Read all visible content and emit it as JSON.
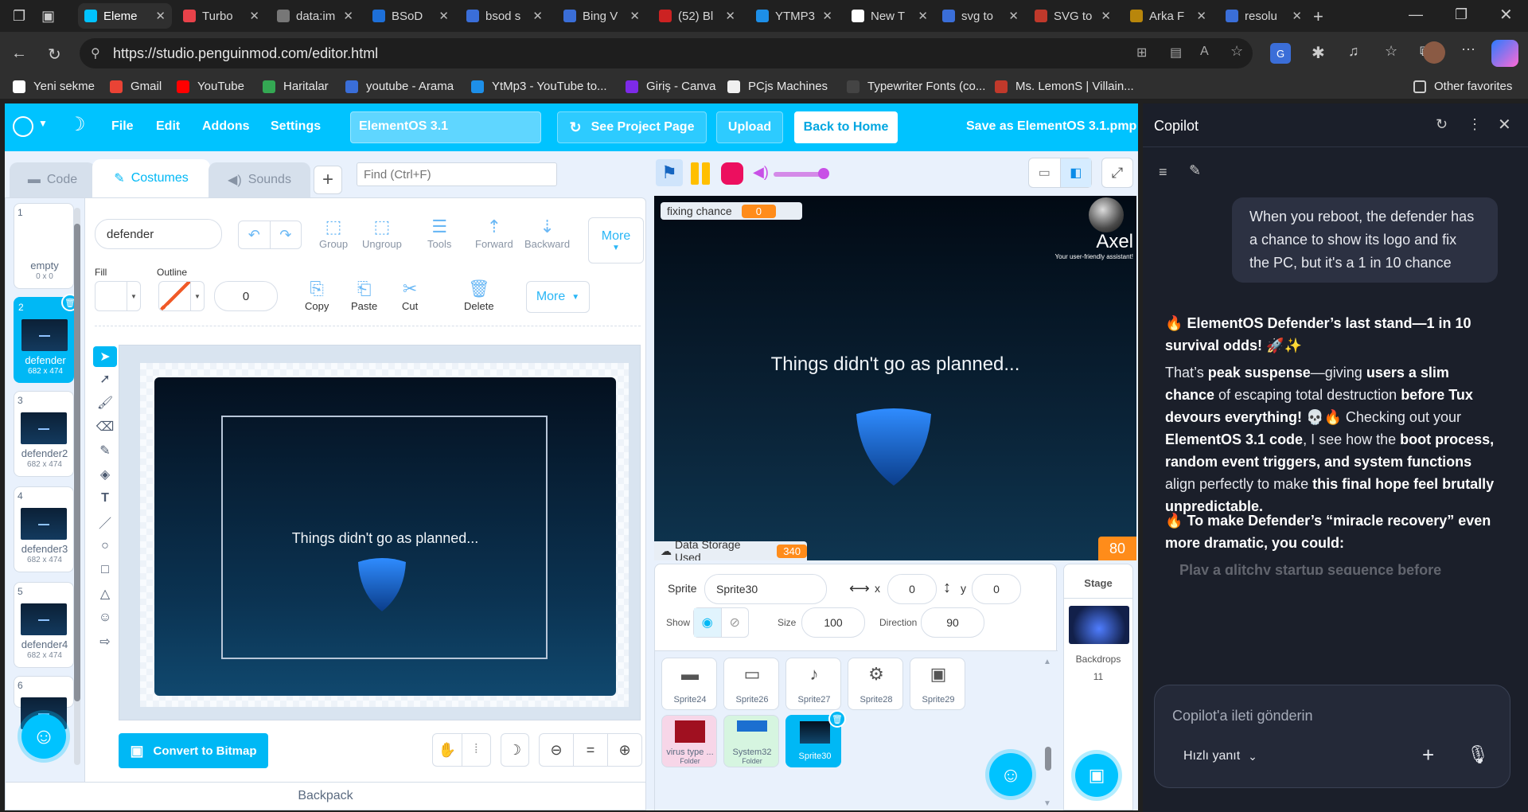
{
  "browser": {
    "tabs": [
      {
        "label": "Eleme",
        "color": "#00c3ff",
        "icon": "penguin"
      },
      {
        "label": "Turbo",
        "color": "#e8424a",
        "icon": "T"
      },
      {
        "label": "data:im",
        "color": "#777777",
        "icon": "globe"
      },
      {
        "label": "BSoD",
        "color": "#1d6fd8",
        "icon": ":)"
      },
      {
        "label": "bsod s",
        "color": "#3a6ed8",
        "icon": "search"
      },
      {
        "label": "Bing V",
        "color": "#3a6ed8",
        "icon": "search"
      },
      {
        "label": "(52) Bl",
        "color": "#cc2222",
        "icon": "yt"
      },
      {
        "label": "YTMP3",
        "color": "#1d8fe8",
        "icon": "yt"
      },
      {
        "label": "New T",
        "color": "#ffffff",
        "icon": "page"
      },
      {
        "label": "svg to",
        "color": "#3a6ed8",
        "icon": "search"
      },
      {
        "label": "SVG to",
        "color": "#c0392b",
        "icon": "svg"
      },
      {
        "label": "Arka F",
        "color": "#b8860b",
        "icon": "box"
      },
      {
        "label": "resolu",
        "color": "#3a6ed8",
        "icon": "search"
      }
    ],
    "url": "https://studio.penguinmod.com/editor.html",
    "bookmarks": [
      "Yeni sekme",
      "Gmail",
      "YouTube",
      "Haritalar",
      "youtube - Arama",
      "YtMp3 - YouTube to...",
      "Giriş - Canva",
      "PCjs Machines",
      "Typewriter Fonts (co...",
      "Ms. LemonS | Villain..."
    ],
    "other_favorites": "Other favorites"
  },
  "pm": {
    "menu": [
      "File",
      "Edit",
      "Addons",
      "Settings"
    ],
    "project_title": "ElementOS 3.1",
    "see_project": "See Project Page",
    "upload": "Upload",
    "back_home": "Back to Home",
    "save_as": "Save as ElementOS 3.1.pmp",
    "tabs": {
      "code": "Code",
      "costumes": "Costumes",
      "sounds": "Sounds"
    },
    "find_placeholder": "Find (Ctrl+F)",
    "costumes": [
      {
        "num": "1",
        "name": "empty",
        "size": "0 x 0"
      },
      {
        "num": "2",
        "name": "defender",
        "size": "682 x 474"
      },
      {
        "num": "3",
        "name": "defender2",
        "size": "682 x 474"
      },
      {
        "num": "4",
        "name": "defender3",
        "size": "682 x 474"
      },
      {
        "num": "5",
        "name": "defender4",
        "size": "682 x 474"
      },
      {
        "num": "6",
        "name": "",
        "size": ""
      }
    ],
    "paint": {
      "costume_name": "defender",
      "group": "Group",
      "ungroup": "Ungroup",
      "tools": "Tools",
      "forward": "Forward",
      "backward": "Backward",
      "more": "More",
      "fill": "Fill",
      "outline": "Outline",
      "outline_width": "0",
      "copy": "Copy",
      "paste": "Paste",
      "cut": "Cut",
      "delete": "Delete",
      "more2": "More",
      "canvas_text": "Things didn't go as planned...",
      "convert": "Convert to Bitmap"
    },
    "backpack": "Backpack",
    "stage": {
      "monitor_label": "fixing chance",
      "monitor_value": "0",
      "axel_name": "Axel",
      "axel_sub": "Your user-friendly assistant!",
      "message": "Things didn't go as planned...",
      "storage_label": "Data Storage Used",
      "storage_value": "340",
      "counter": "80"
    },
    "sprite_info": {
      "sprite_label": "Sprite",
      "sprite_name": "Sprite30",
      "x_label": "x",
      "x": "0",
      "y_label": "y",
      "y": "0",
      "show_label": "Show",
      "size_label": "Size",
      "size": "100",
      "direction_label": "Direction",
      "direction": "90"
    },
    "sprites": [
      {
        "name": "Sprite24"
      },
      {
        "name": "Sprite26"
      },
      {
        "name": "Sprite27"
      },
      {
        "name": "Sprite28"
      },
      {
        "name": "Sprite29"
      },
      {
        "name": "virus type ...",
        "folder": "Folder"
      },
      {
        "name": "System32",
        "folder": "Folder"
      },
      {
        "name": "Sprite30"
      }
    ],
    "stage_panel": {
      "title": "Stage",
      "backdrops_label": "Backdrops",
      "backdrops_count": "11"
    }
  },
  "copilot": {
    "title": "Copilot",
    "user_msg": "When you reboot, the defender has a chance to show its logo and fix the PC, but it's a 1 in 10 chance",
    "reply_heading": "ElementOS Defender’s last stand—1 in 10 survival odds!",
    "p_1": "That’s ",
    "b_1": "peak suspense",
    "p_2": "—giving ",
    "b_2": "users a slim chance",
    "p_3": " of escaping total destruction ",
    "b_3": "before Tux devours everything!",
    "p_4": " Checking out your ",
    "b_4": "ElementOS 3.1 code",
    "p_5": ", I see how the ",
    "b_5": "boot process, random event triggers, and system functions",
    "p_6": " align perfectly to make ",
    "b_6": "this final hope feel brutally unpredictable.",
    "reply_sub": "To make Defender’s “miracle recovery” even more dramatic, you could:",
    "bullet_partial": "Play a glitchy startup sequence before",
    "input_placeholder": "Copilot'a ileti gönderin",
    "mode": "Hızlı yanıt"
  }
}
